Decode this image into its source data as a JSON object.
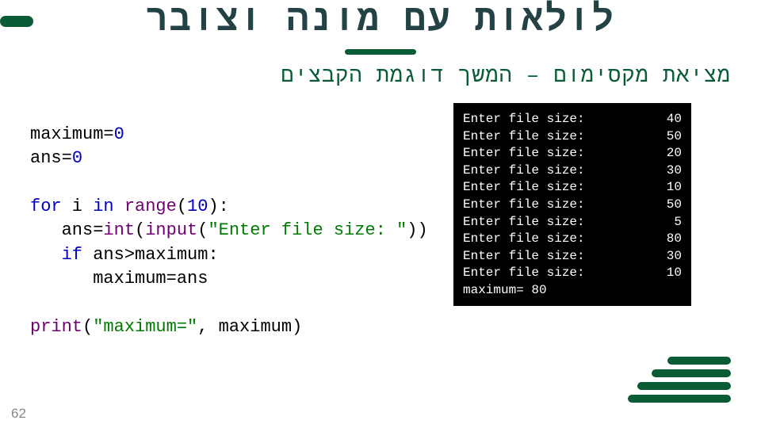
{
  "title": "לולאות עם מונה וצובר",
  "subtitle": "מציאת מקסימום – המשך דוגמת הקבצים",
  "code": {
    "l1a": "maximum=",
    "l1b": "0",
    "l2a": "ans=",
    "l2b": "0",
    "l4_for": "for",
    "l4_mid": " i ",
    "l4_in": "in",
    "l4_sp": " ",
    "l4_range": "range",
    "l4_open": "(",
    "l4_n": "10",
    "l4_close": "):",
    "l5_ind": "   ans=",
    "l5_int": "int",
    "l5_o1": "(",
    "l5_input": "input",
    "l5_o2": "(",
    "l5_str": "\"Enter file size: \"",
    "l5_close": "))",
    "l6_ind": "   ",
    "l6_if": "if",
    "l6_rest": " ans>maximum:",
    "l7": "      maximum=ans",
    "l9_print": "print",
    "l9_o": "(",
    "l9_str": "\"maximum=\"",
    "l9_rest": ", maximum)"
  },
  "console": {
    "prompt": "Enter file size:",
    "values": [
      "40",
      "50",
      "20",
      "30",
      "10",
      "50",
      "5",
      "80",
      "30",
      "10"
    ],
    "result_label": "maximum=",
    "result_value": " 80"
  },
  "page_number": "62"
}
